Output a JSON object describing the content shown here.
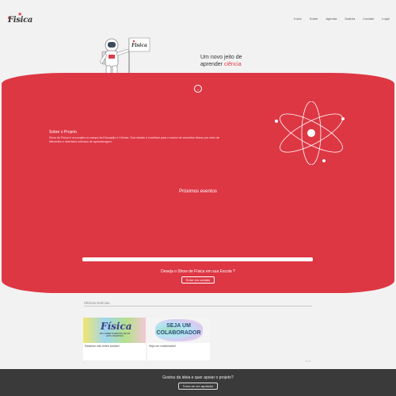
{
  "header": {
    "logo_text": "Fisica",
    "nav": [
      "Início",
      "Sobre",
      "Agenda",
      "Galeria",
      "Contato",
      "Login"
    ]
  },
  "hero": {
    "tagline_line1": "Um novo jeito de",
    "tagline_line2_plain": "aprender ",
    "tagline_line2_accent": "ciência",
    "flag_text": "Fisica",
    "scroll_glyph": "⌄"
  },
  "about": {
    "title": "Sobre o Projeto",
    "text": "Show de Física é um projeto no campo da Educação e Ciência. Sua missão é contribuir para o ensino de conceitos físicos por meio de diferentes e divertidos métodos de aprendizagem."
  },
  "events": {
    "title": "Próximos eventos",
    "progress_fraction": 1.0
  },
  "cta": {
    "question": "Deseja o Show de Física em sua Escola ?",
    "button_label": "Entre em contato"
  },
  "news": {
    "title": "Últimas Notícias",
    "cards": [
      {
        "thumb_big": "Física",
        "thumb_small": "PRA SABER DIVERTIDO DE UM JEITO DIVERTIDO",
        "caption": "Estamos nas redes sociais!"
      },
      {
        "thumb_line1": "SEJA UM",
        "thumb_line2": "COLABORADOR",
        "caption": "Seja um colaborador!"
      }
    ],
    "pager_left": "•",
    "pager_right": "1 / 2"
  },
  "footer": {
    "question": "Gostou da ideia e quer apoiar o projeto?",
    "button_label": "Torne-se um apoiador"
  },
  "colors": {
    "accent": "#dd3744",
    "footer": "#3a3a3a",
    "background": "#f2f2f2"
  }
}
